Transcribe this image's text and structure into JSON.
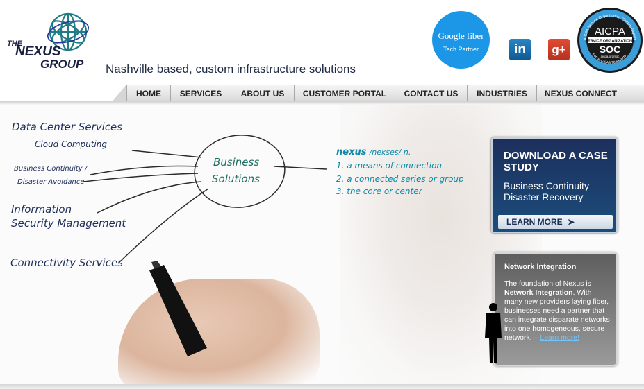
{
  "brand": {
    "logo_text_the": "THE",
    "logo_text_nexus": "NEXUS",
    "logo_text_group": "GROUP",
    "tagline": "Nashville based, custom infrastructure solutions"
  },
  "badges": {
    "google_fiber_line1": "Google fiber",
    "google_fiber_line2": "Tech Partner",
    "linkedin": "in",
    "google_plus": "g+",
    "aicpa_arc": "AICPA Service Organization Control Reports",
    "aicpa_title": "AICPA",
    "aicpa_band": "SERVICE ORGANIZATIONS",
    "aicpa_soc": "SOC",
    "aicpa_url": "aicpa.org/soc",
    "aicpa_formerly": "Formerly SAS 70 Reports"
  },
  "nav": {
    "items": [
      "HOME",
      "SERVICES",
      "ABOUT US",
      "CUSTOMER PORTAL",
      "CONTACT US",
      "INDUSTRIES",
      "NEXUS CONNECT"
    ]
  },
  "hero": {
    "services": {
      "data_center": "Data Center Services",
      "cloud": "Cloud Computing",
      "continuity_1": "Business Continuity /",
      "continuity_2": "Disaster Avoidance",
      "infosec_1": "Information",
      "infosec_2": "Security Management",
      "connectivity": "Connectivity Services"
    },
    "center_1": "Business",
    "center_2": "Solutions",
    "definition": {
      "word": "nexus",
      "pron": "/nekses/ n.",
      "line1": "1. a means of connection",
      "line2": "2. a connected series or group",
      "line3": "3. the core or center"
    }
  },
  "cta": {
    "title": "DOWNLOAD A CASE STUDY",
    "subtitle": "Business Continuity Disaster Recovery",
    "button": "LEARN MORE"
  },
  "info": {
    "title": "Network Integration",
    "body_start": "The foundation of Nexus is",
    "body_bold": "Network Integration",
    "body_rest": ". With many new providers laying fiber, businesses need a partner that can integrate disparate networks into one homogeneous, secure network. –",
    "link": "Learn more!"
  },
  "colors": {
    "brand_navy": "#1d2a44",
    "handwriting_teal": "#0e8aa8",
    "cta_blue": "#1d2f5c",
    "google_fiber": "#1c97e8"
  }
}
